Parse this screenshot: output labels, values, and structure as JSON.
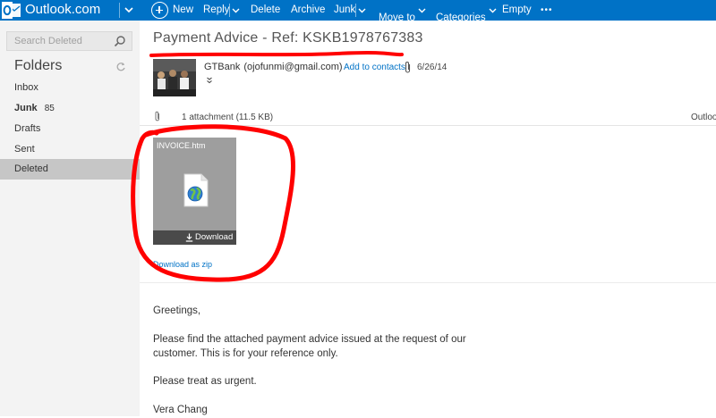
{
  "app": {
    "brand": "Outlook.com",
    "accent_color": "#0072c6",
    "highlight_color": "#ff0000"
  },
  "toolbar": {
    "items": [
      {
        "label": "New",
        "icon": "plus-circle-icon"
      },
      {
        "label": "Reply",
        "has_dropdown": true
      },
      {
        "label": "Delete"
      },
      {
        "label": "Archive"
      },
      {
        "label": "Junk",
        "has_dropdown": true
      },
      {
        "label": "Move to",
        "has_dropdown": true
      },
      {
        "label": "Categories",
        "has_dropdown": true
      },
      {
        "label": "Empty"
      },
      {
        "label": "•••"
      }
    ]
  },
  "sidebar": {
    "search_placeholder": "Search Deleted",
    "folders_title": "Folders",
    "items": [
      {
        "label": "Inbox",
        "count": ""
      },
      {
        "label": "Junk",
        "count": "85"
      },
      {
        "label": "Drafts",
        "count": ""
      },
      {
        "label": "Sent",
        "count": ""
      },
      {
        "label": "Deleted",
        "count": "",
        "selected": true
      }
    ]
  },
  "message": {
    "subject": "Payment Advice - Ref: KSKB1978767383",
    "sender_name": "GTBank",
    "sender_email": "(ojofunmi@gmail.com)",
    "add_to_contacts": "Add to contacts",
    "date": "6/26/14",
    "expand_glyph": "»",
    "attachments_summary": "1 attachment (11.5 KB)",
    "attachments_right": "Outloo",
    "attachment": {
      "file_name": "INVOICE.htm",
      "download_label": "Download"
    },
    "download_zip": "Download as zip",
    "body": [
      "Greetings,",
      "Please find the attached payment advice issued at the request of our",
      "customer. This is for your reference only.",
      "Please treat as urgent.",
      "Vera Chang"
    ]
  }
}
